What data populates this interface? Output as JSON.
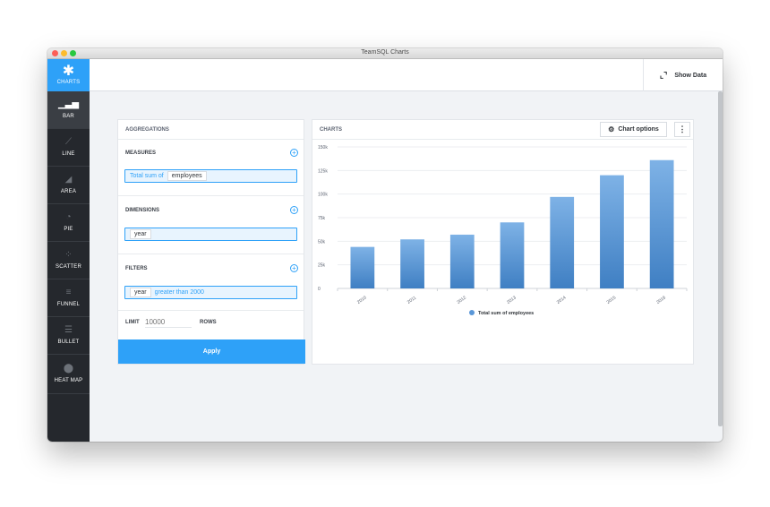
{
  "window": {
    "title": "TeamSQL Charts"
  },
  "sidebar": {
    "items": [
      {
        "label": "CHARTS",
        "icon": "asterisk-icon",
        "glyph": "✱"
      },
      {
        "label": "BAR",
        "icon": "bar-chart-icon",
        "glyph": "▁▃▅"
      },
      {
        "label": "LINE",
        "icon": "line-chart-icon",
        "glyph": "⟋"
      },
      {
        "label": "AREA",
        "icon": "area-chart-icon",
        "glyph": "◢"
      },
      {
        "label": "PIE",
        "icon": "pie-chart-icon",
        "glyph": "◔"
      },
      {
        "label": "SCATTER",
        "icon": "scatter-chart-icon",
        "glyph": "⁘"
      },
      {
        "label": "FUNNEL",
        "icon": "funnel-icon",
        "glyph": "≡"
      },
      {
        "label": "BULLET",
        "icon": "bullet-chart-icon",
        "glyph": "☰"
      },
      {
        "label": "HEAT MAP",
        "icon": "heat-map-icon",
        "glyph": "⬤"
      }
    ]
  },
  "topbar": {
    "show_data_label": "Show Data",
    "show_data_icon": "⌞⌝"
  },
  "aggregations": {
    "title": "AGGREGATIONS",
    "measures": {
      "title": "MEASURES",
      "func": "Total sum of",
      "field": "employees"
    },
    "dimensions": {
      "title": "DIMENSIONS",
      "field": "year"
    },
    "filters": {
      "title": "FILTERS",
      "field": "year",
      "condition": "greater than 2000"
    },
    "limit": {
      "label": "LIMIT",
      "placeholder": "10000",
      "rows_label": "ROWS"
    },
    "apply_label": "Apply"
  },
  "charts_panel": {
    "title": "CHARTS",
    "chart_options_label": "Chart options",
    "more_glyph": "⋮"
  },
  "colors": {
    "accent": "#2ea1f8",
    "bar_top": "#7eb2e6",
    "bar_bottom": "#3f7fc3",
    "sidebar": "#25282d"
  },
  "chart_data": {
    "type": "bar",
    "categories": [
      "2010",
      "2011",
      "2012",
      "2013",
      "2014",
      "2015",
      "2016"
    ],
    "series": [
      {
        "name": "Total sum of employees",
        "values": [
          44000,
          52000,
          57000,
          70000,
          97000,
          120000,
          136000
        ]
      }
    ],
    "yticks": [
      0,
      25000,
      50000,
      75000,
      100000,
      125000,
      150000
    ],
    "ytick_labels": [
      "0",
      "25k",
      "50k",
      "75k",
      "100k",
      "125k",
      "150k"
    ],
    "ylim": [
      0,
      150000
    ],
    "grid": true,
    "legend": "bottom"
  }
}
